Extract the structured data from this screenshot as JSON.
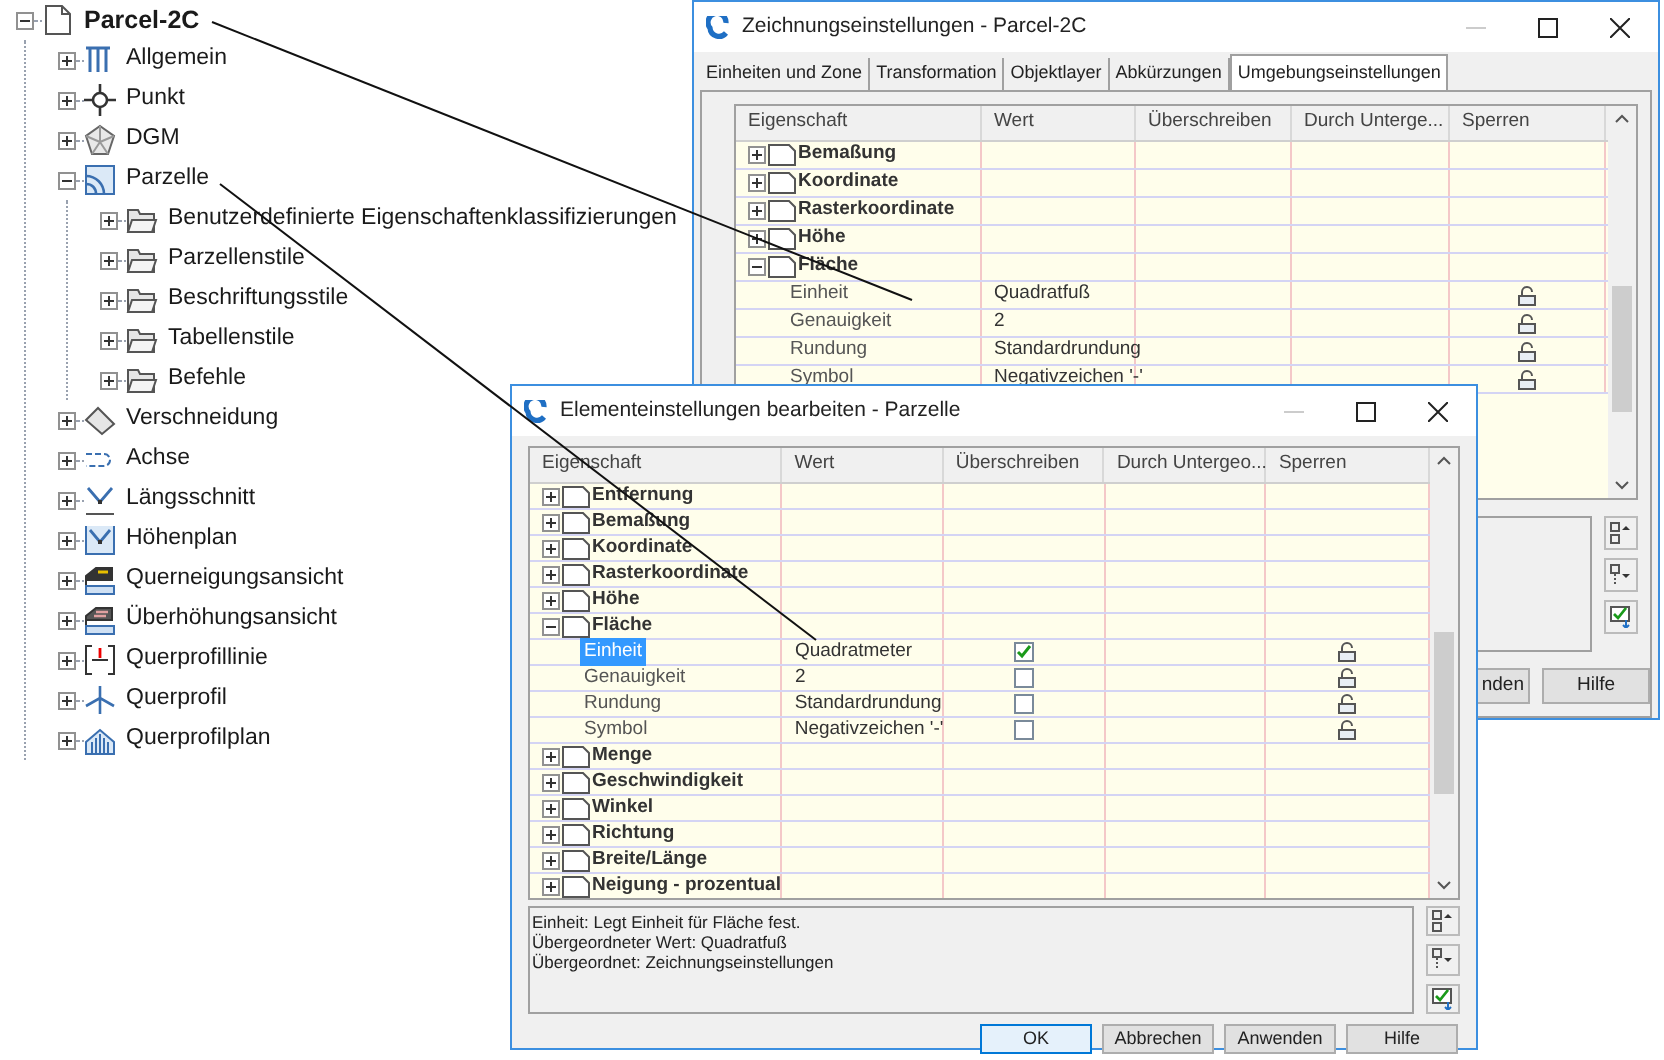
{
  "tree": {
    "label": "Parcel-2C",
    "kind": "drawing",
    "expanded": true,
    "children": [
      {
        "label": "Allgemein",
        "kind": "general",
        "expanded": false
      },
      {
        "label": "Punkt",
        "kind": "point",
        "expanded": false
      },
      {
        "label": "DGM",
        "kind": "surface",
        "expanded": false
      },
      {
        "label": "Parzelle",
        "kind": "parcel",
        "expanded": true,
        "children": [
          {
            "label": "Benutzerdefinierte Eigenschaftenklassifizierungen",
            "kind": "folder",
            "expanded": false
          },
          {
            "label": "Parzellenstile",
            "kind": "folder",
            "expanded": false
          },
          {
            "label": "Beschriftungsstile",
            "kind": "folder",
            "expanded": false
          },
          {
            "label": "Tabellenstile",
            "kind": "folder",
            "expanded": false
          },
          {
            "label": "Befehle",
            "kind": "folder",
            "expanded": false
          }
        ]
      },
      {
        "label": "Verschneidung",
        "kind": "grading",
        "expanded": false
      },
      {
        "label": "Achse",
        "kind": "alignment",
        "expanded": false
      },
      {
        "label": "Längsschnitt",
        "kind": "profile",
        "expanded": false
      },
      {
        "label": "Höhenplan",
        "kind": "profile_view",
        "expanded": false
      },
      {
        "label": "Querneigungsansicht",
        "kind": "superelevation",
        "expanded": false
      },
      {
        "label": "Überhöhungsansicht",
        "kind": "cant",
        "expanded": false
      },
      {
        "label": "Querprofillinie",
        "kind": "sample_line",
        "expanded": false
      },
      {
        "label": "Querprofil",
        "kind": "section",
        "expanded": false
      },
      {
        "label": "Querprofilplan",
        "kind": "section_view",
        "expanded": false
      }
    ]
  },
  "drawing_settings": {
    "title": "Zeichnungseinstellungen - Parcel-2C",
    "tabs": [
      {
        "label": "Einheiten und Zone",
        "selected": false
      },
      {
        "label": "Transformation",
        "selected": false
      },
      {
        "label": "Objektlayer",
        "selected": false
      },
      {
        "label": "Abkürzungen",
        "selected": false
      },
      {
        "label": "Umgebungseinstellungen",
        "selected": true
      }
    ],
    "columns": [
      "Eigenschaft",
      "Wert",
      "Überschreiben",
      "Durch Unterge...",
      "Sperren"
    ],
    "rows": [
      {
        "kind": "group",
        "label": "Bemaßung",
        "expanded": false
      },
      {
        "kind": "group",
        "label": "Koordinate",
        "expanded": false
      },
      {
        "kind": "group",
        "label": "Rasterkoordinate",
        "expanded": false
      },
      {
        "kind": "group",
        "label": "Höhe",
        "expanded": false
      },
      {
        "kind": "group",
        "label": "Fläche",
        "expanded": true
      },
      {
        "kind": "property",
        "label": "Einheit",
        "value": "Quadratfuß",
        "locked": false,
        "selected": false
      },
      {
        "kind": "property",
        "label": "Genauigkeit",
        "value": "2",
        "locked": false,
        "selected": false
      },
      {
        "kind": "property",
        "label": "Rundung",
        "value": "Standardrundung",
        "locked": false,
        "selected": false
      },
      {
        "kind": "property",
        "label": "Symbol",
        "value": "Negativzeichen '-'",
        "locked": false,
        "selected": false
      }
    ],
    "buttons": [
      "nden",
      "Hilfe"
    ]
  },
  "element_settings": {
    "title": "Elementeinstellungen bearbeiten - Parzelle",
    "columns": [
      "Eigenschaft",
      "Wert",
      "Überschreiben",
      "Durch Untergeo...",
      "Sperren"
    ],
    "rows": [
      {
        "kind": "group",
        "label": "Entfernung",
        "expanded": false
      },
      {
        "kind": "group",
        "label": "Bemaßung",
        "expanded": false
      },
      {
        "kind": "group",
        "label": "Koordinate",
        "expanded": false
      },
      {
        "kind": "group",
        "label": "Rasterkoordinate",
        "expanded": false
      },
      {
        "kind": "group",
        "label": "Höhe",
        "expanded": false
      },
      {
        "kind": "group",
        "label": "Fläche",
        "expanded": true
      },
      {
        "kind": "property",
        "label": "Einheit",
        "value": "Quadratmeter",
        "overridden": true,
        "locked": false,
        "selected": true
      },
      {
        "kind": "property",
        "label": "Genauigkeit",
        "value": "2",
        "overridden": false,
        "locked": false,
        "selected": false
      },
      {
        "kind": "property",
        "label": "Rundung",
        "value": "Standardrundung",
        "overridden": false,
        "locked": false,
        "selected": false
      },
      {
        "kind": "property",
        "label": "Symbol",
        "value": "Negativzeichen '-'",
        "overridden": false,
        "locked": false,
        "selected": false
      },
      {
        "kind": "group",
        "label": "Menge",
        "expanded": false
      },
      {
        "kind": "group",
        "label": "Geschwindigkeit",
        "expanded": false
      },
      {
        "kind": "group",
        "label": "Winkel",
        "expanded": false
      },
      {
        "kind": "group",
        "label": "Richtung",
        "expanded": false
      },
      {
        "kind": "group",
        "label": "Breite/Länge",
        "expanded": false
      },
      {
        "kind": "group",
        "label": "Neigung - prozentual",
        "expanded": false
      }
    ],
    "description": [
      "Einheit: Legt Einheit für Fläche fest.",
      "Übergeordneter Wert: Quadratfuß",
      "Übergeordnet: Zeichnungseinstellungen"
    ],
    "buttons": [
      "OK",
      "Abbrechen",
      "Anwenden",
      "Hilfe"
    ]
  }
}
